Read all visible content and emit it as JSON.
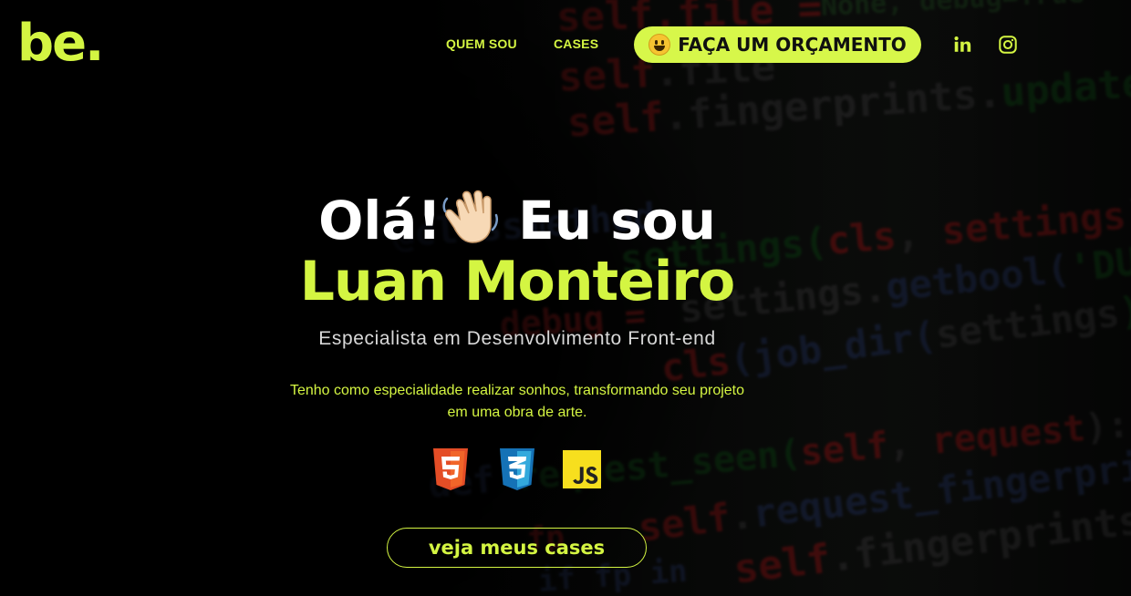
{
  "header": {
    "logo_text": "be.",
    "nav": [
      {
        "label": "QUEM SOU"
      },
      {
        "label": "CASES"
      }
    ],
    "cta_label": "FAÇA UM ORÇAMENTO",
    "cta_icon": "smiley-emoji-icon",
    "social_icons": [
      "linkedin-icon",
      "instagram-icon"
    ]
  },
  "hero": {
    "greeting_prefix": "Olá!",
    "greeting_suffix": " Eu sou",
    "wave_icon": "waving-hand-icon",
    "name": "Luan Monteiro",
    "subtitle": "Especialista em Desenvolvimento Front-end",
    "description": "Tenho como especialidade realizar sonhos, transformando seu projeto em uma obra de arte.",
    "tech_icons": [
      "html5-icon",
      "css3-icon",
      "javascript-icon"
    ],
    "cases_button": "veja meus cases"
  },
  "colors": {
    "accent": "#d4f542",
    "cta_background": "#d7f74a",
    "background": "#000000",
    "text_white": "#ffffff"
  }
}
